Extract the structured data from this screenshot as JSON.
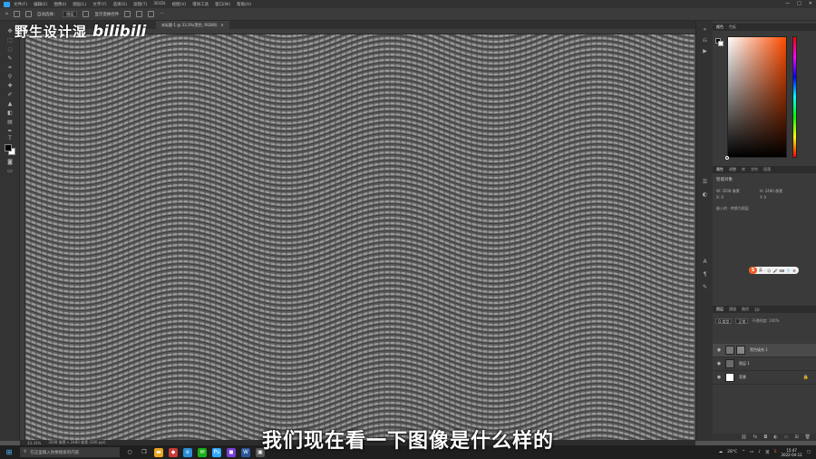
{
  "menubar": {
    "items": [
      "文件(F)",
      "编辑(E)",
      "图像(I)",
      "图层(L)",
      "文字(Y)",
      "选择(S)",
      "滤镜(T)",
      "3D(D)",
      "视图(V)",
      "增效工具",
      "窗口(W)",
      "帮助(H)"
    ],
    "controls": [
      "—",
      "□",
      "✕"
    ]
  },
  "optbar": {
    "auto_select": "自动选择：",
    "target": "图层",
    "transform": "显示变换控件"
  },
  "watermark": {
    "text": "野生设计湿",
    "logo": "bilibili"
  },
  "doc": {
    "tab_title": "未标题-1 @ 33.3%(黑色, RGB/8)",
    "tab_close": "✕",
    "zoom": "33.33%",
    "size": "3508 像素 x 2480 像素 (300 ppi)"
  },
  "subtitle": "我们现在看一下图像是什么样的",
  "panels": {
    "color_tabs": [
      "颜色",
      "色板"
    ],
    "prop_tabs": [
      "属性",
      "调整",
      "库",
      "字符",
      "段落"
    ],
    "prop_title": "智能对象",
    "prop_w": "W: 3508 像素",
    "prop_h": "H: 2480 像素",
    "prop_x": "X: 0",
    "prop_y": "Y: 0",
    "prop_note": "嵌入的 · 转换为图层",
    "layer_tabs": [
      "图层",
      "通道",
      "路径",
      "3D"
    ],
    "layer_kind": "Q 类型",
    "layer_mode": "正常",
    "layer_opacity": "不透明度: 100%",
    "layers": [
      {
        "name": "黑色填充 1",
        "selected": true
      },
      {
        "name": "图层 1",
        "selected": false
      },
      {
        "name": "背景",
        "selected": false,
        "locked": true
      }
    ]
  },
  "ime": {
    "logo": "S",
    "items": [
      "英",
      "·",
      "☺",
      "🎤",
      "⌨",
      "👕",
      "⚙"
    ]
  },
  "taskbar": {
    "search_placeholder": "在这里输入你要搜索的内容",
    "weather": "28°C",
    "ime_label": "英",
    "time": "15:47",
    "date": "2022-04-12"
  }
}
